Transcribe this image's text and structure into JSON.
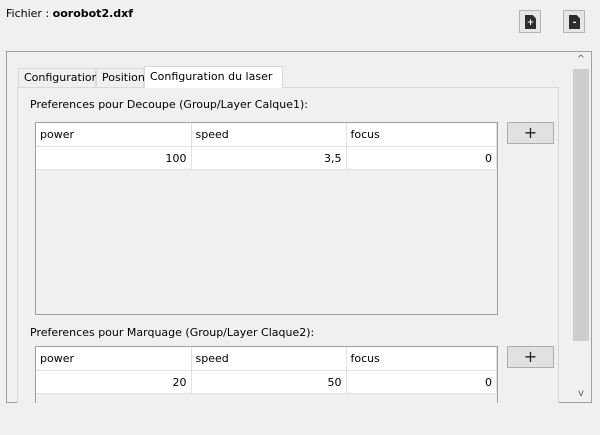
{
  "file": {
    "label": "Fichier :",
    "name": "oorobot2.dxf"
  },
  "toolbar": {
    "new_icon": "file-plus-icon",
    "delete_icon": "file-minus-icon"
  },
  "tabs": [
    {
      "label": "Configuration"
    },
    {
      "label": "Position"
    },
    {
      "label": "Configuration du laser"
    }
  ],
  "cut": {
    "label": "Preferences pour Decoupe (Group/Layer Calque1):",
    "headers": [
      "power",
      "speed",
      "focus"
    ],
    "row": [
      "100",
      "3,5",
      "0"
    ],
    "add": "+"
  },
  "mark": {
    "label": "Preferences pour Marquage (Group/Layer Claque2):",
    "headers": [
      "power",
      "speed",
      "focus"
    ],
    "row": [
      "20",
      "50",
      "0"
    ],
    "add": "+"
  },
  "scrollbar": {
    "up": "^",
    "down": "v"
  }
}
